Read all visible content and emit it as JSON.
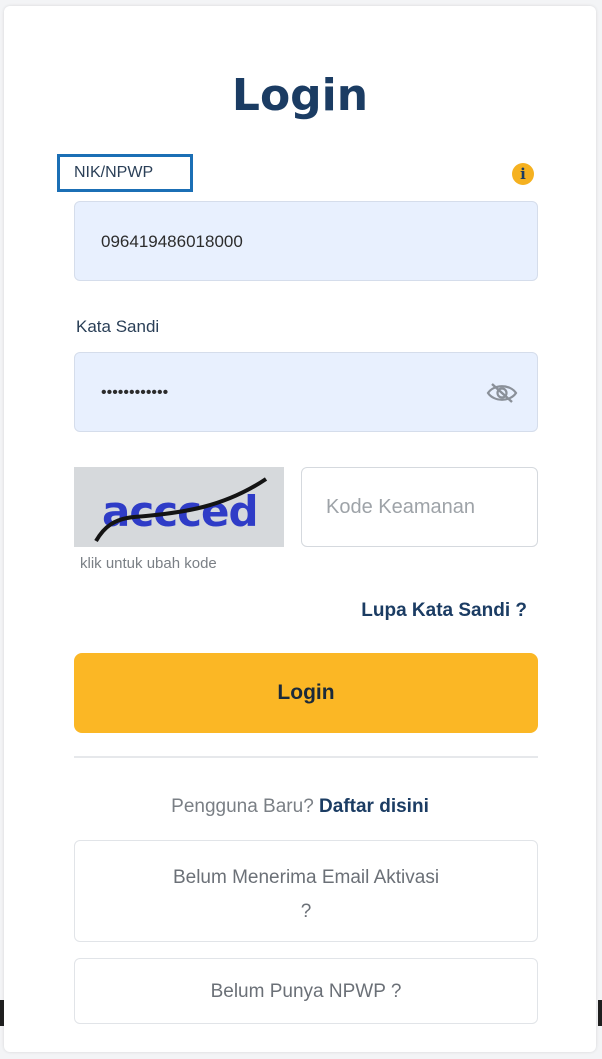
{
  "page": {
    "title": "Login"
  },
  "nik": {
    "label": "NIK/NPWP",
    "value": "096419486018000",
    "info_icon": "info-icon"
  },
  "password": {
    "label": "Kata Sandi",
    "value": "••••••••••••",
    "toggle_icon": "eye-slash-icon"
  },
  "captcha": {
    "image_text": "accced",
    "hint": "klik untuk ubah kode",
    "input_placeholder": "Kode Keamanan"
  },
  "links": {
    "forgot_password": "Lupa Kata Sandi ?"
  },
  "actions": {
    "login_label": "Login",
    "new_user_prefix": "Pengguna Baru?",
    "register_link": "Daftar disini",
    "resend_activation_line1": "Belum Menerima Email Aktivasi",
    "resend_activation_line2": "?",
    "no_npwp": "Belum Punya NPWP ?"
  },
  "colors": {
    "primary_navy": "#1b3c63",
    "accent_yellow": "#fbb725",
    "field_bg": "#e8f0fe",
    "highlight_border": "#1b6fb5"
  }
}
